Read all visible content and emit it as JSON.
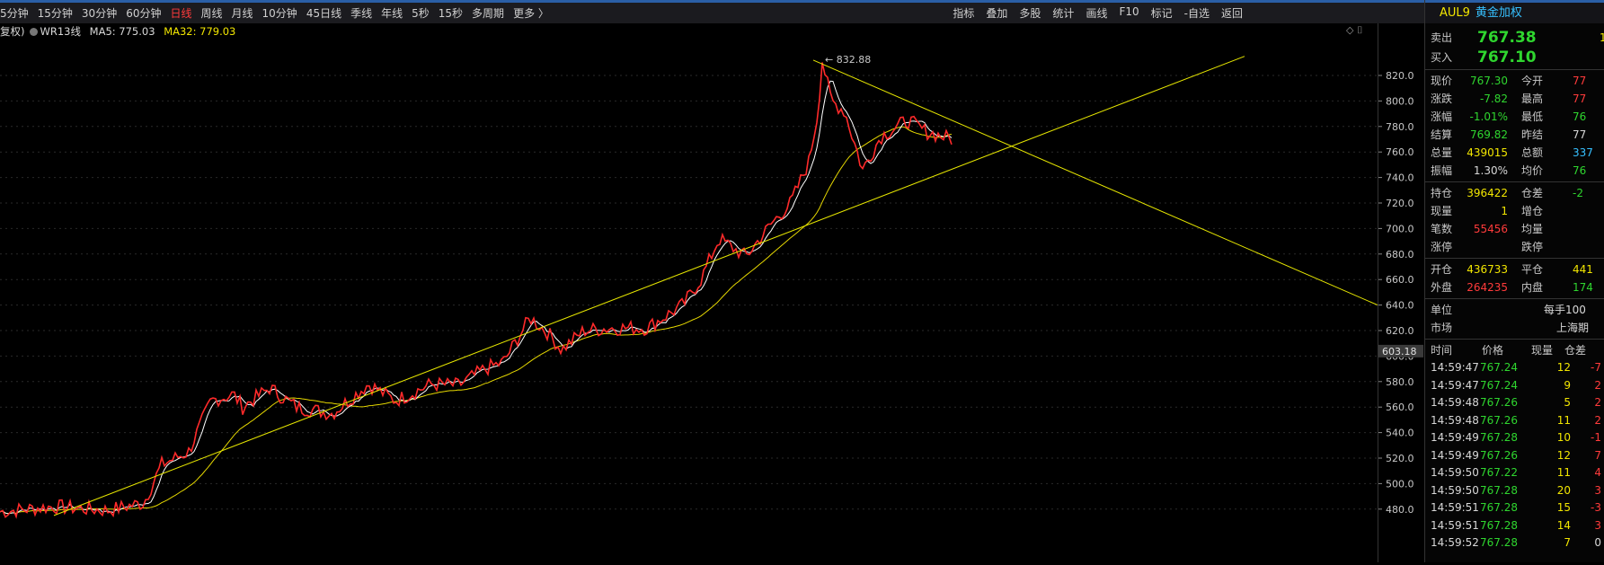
{
  "toolbar": {
    "periods": [
      "5分钟",
      "15分钟",
      "30分钟",
      "60分钟",
      "日线",
      "周线",
      "月线",
      "10分钟",
      "45日线",
      "季线",
      "年线",
      "5秒",
      "15秒",
      "多周期",
      "更多 〉"
    ],
    "active_period": "日线",
    "tools": [
      "指标",
      "叠加",
      "多股",
      "统计",
      "画线",
      "F10",
      "标记",
      "-自选",
      "返回"
    ]
  },
  "chart_info": {
    "prefix": "复权)",
    "indicator": "WR13线",
    "ma5": "MA5: 775.03",
    "ma32": "MA32: 779.03",
    "corner_icons": "◇ ⌷"
  },
  "chart": {
    "peak_label": "832.88",
    "cursor_price": "603.18",
    "y_ticks": [
      "820.0",
      "800.0",
      "780.0",
      "760.0",
      "740.0",
      "720.0",
      "700.0",
      "680.0",
      "660.0",
      "640.0",
      "620.0",
      "600.0",
      "580.0",
      "560.0",
      "540.0",
      "520.0",
      "500.0",
      "480.0"
    ],
    "colors": {
      "price": "#ff2a2a",
      "ma5": "#ffffff",
      "ma32": "#e6d800",
      "trend": "#e6e600"
    }
  },
  "panel": {
    "code": "AUL9",
    "name": "黄金加权",
    "ask_label": "卖出",
    "ask": "767.38",
    "ask_vol": "1",
    "bid_label": "买入",
    "bid": "767.10",
    "quote": [
      {
        "l1": "现价",
        "v1": "767.30",
        "l2": "今开",
        "v2": "77"
      },
      {
        "l1": "涨跌",
        "v1": "-7.82",
        "l2": "最高",
        "v2": "77"
      },
      {
        "l1": "涨幅",
        "v1": "-1.01%",
        "l2": "最低",
        "v2": "76"
      },
      {
        "l1": "结算",
        "v1": "769.82",
        "l2": "昨结",
        "v2": "77"
      },
      {
        "l1": "总量",
        "v1": "439015",
        "l2": "总额",
        "v2": "337"
      },
      {
        "l1": "振幅",
        "v1": "1.30%",
        "l2": "均价",
        "v2": "76"
      }
    ],
    "position": [
      {
        "l1": "持仓",
        "v1": "396422",
        "l2": "仓差",
        "v2": "-2"
      },
      {
        "l1": "现量",
        "v1": "1",
        "l2": "增仓",
        "v2": ""
      },
      {
        "l1": "笔数",
        "v1": "55456",
        "l2": "均量",
        "v2": ""
      },
      {
        "l1": "涨停",
        "v1": "",
        "l2": "跌停",
        "v2": ""
      }
    ],
    "openclose": [
      {
        "l1": "开仓",
        "v1": "436733",
        "l2": "平仓",
        "v2": "441"
      },
      {
        "l1": "外盘",
        "v1": "264235",
        "l2": "内盘",
        "v2": "174"
      }
    ],
    "unit_label": "单位",
    "unit_value": "每手100",
    "market_label": "市场",
    "market_value": "上海期",
    "ticks_header": [
      "时间",
      "价格",
      "现量",
      "仓差"
    ],
    "ticks": [
      {
        "t": "14:59:47",
        "p": "767.24",
        "v": "12",
        "d": "-7"
      },
      {
        "t": "14:59:47",
        "p": "767.24",
        "v": "9",
        "d": "2"
      },
      {
        "t": "14:59:48",
        "p": "767.26",
        "v": "5",
        "d": "2"
      },
      {
        "t": "14:59:48",
        "p": "767.26",
        "v": "11",
        "d": "2"
      },
      {
        "t": "14:59:49",
        "p": "767.28",
        "v": "10",
        "d": "-1"
      },
      {
        "t": "14:59:49",
        "p": "767.26",
        "v": "12",
        "d": "7"
      },
      {
        "t": "14:59:50",
        "p": "767.22",
        "v": "11",
        "d": "4"
      },
      {
        "t": "14:59:50",
        "p": "767.28",
        "v": "20",
        "d": "3"
      },
      {
        "t": "14:59:51",
        "p": "767.28",
        "v": "15",
        "d": "-3"
      },
      {
        "t": "14:59:51",
        "p": "767.28",
        "v": "14",
        "d": "3"
      },
      {
        "t": "14:59:52",
        "p": "767.28",
        "v": "7",
        "d": "0"
      }
    ]
  }
}
